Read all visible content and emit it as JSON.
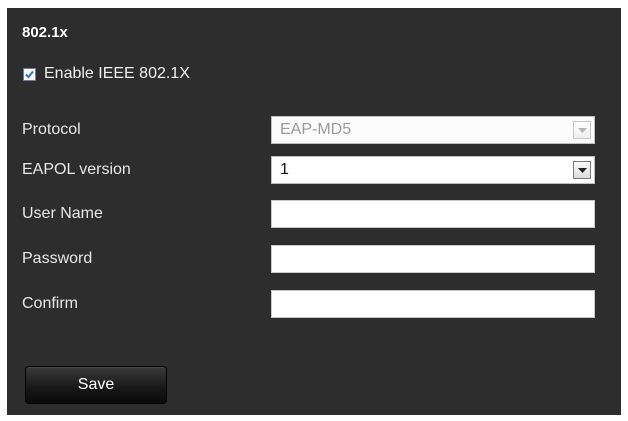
{
  "section": {
    "title": "802.1x"
  },
  "enable": {
    "label": "Enable IEEE 802.1X",
    "checked": true
  },
  "form": {
    "protocol": {
      "label": "Protocol",
      "value": "EAP-MD5",
      "disabled": true
    },
    "eapol": {
      "label": "EAPOL version",
      "value": "1"
    },
    "username": {
      "label": "User Name",
      "value": ""
    },
    "password": {
      "label": "Password",
      "value": ""
    },
    "confirm": {
      "label": "Confirm",
      "value": ""
    }
  },
  "actions": {
    "save_label": "Save"
  },
  "colors": {
    "panel_bg": "#2d2d2d",
    "text": "#e8e8e8",
    "button_bg": "#171717",
    "checkbox_check": "#3b6cc9"
  },
  "icons": {
    "checkbox": "check-icon",
    "dropdown": "chevron-down-icon"
  }
}
